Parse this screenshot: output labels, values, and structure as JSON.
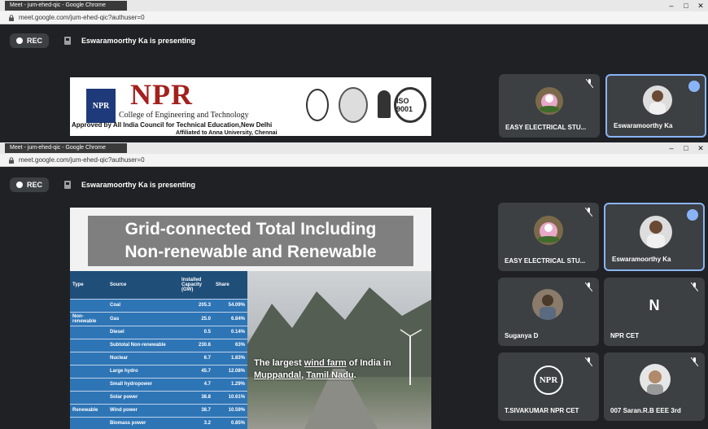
{
  "top_window": {
    "tab_title": "Meet - jum-ehed-qic - Google Chrome",
    "url": "meet.google.com/jum-ehed-qic?authuser=0",
    "rec_label": "REC",
    "presenting": "Eswaramoorthy Ka is presenting",
    "slide": {
      "logo_text": "NPR",
      "college_name": "NPR",
      "college_sub": "College of Engineering and Technology",
      "approval": "Approved by All India Council for Technical Education,New Delhi",
      "affiliation": "Affiliated to Anna University, Chennai",
      "seal_iso": "ISO 9001"
    },
    "tiles": [
      {
        "name": "EASY ELECTRICAL STU..."
      },
      {
        "name": "Eswaramoorthy Ka"
      }
    ]
  },
  "bottom_window": {
    "tab_title": "Meet - jum-ehed-qic - Google Chrome",
    "url": "meet.google.com/jum-ehed-qic?authuser=0",
    "rec_label": "REC",
    "presenting": "Eswaramoorthy Ka is presenting",
    "slide": {
      "title_line1": "Grid-connected Total Including",
      "title_line2": "Non-renewable and Renewable",
      "headers": [
        "Type",
        "Source",
        "Installed Capacity (GW)",
        "Share"
      ],
      "rows": [
        {
          "type": "",
          "source": "Coal",
          "capacity": "205.3",
          "share": "54.09%"
        },
        {
          "type": "Non-renewable",
          "source": "Gas",
          "capacity": "25.0",
          "share": "6.84%"
        },
        {
          "type": "",
          "source": "Diesel",
          "capacity": "0.5",
          "share": "0.14%"
        },
        {
          "type": "",
          "source": "Subtotal Non-renewable",
          "capacity": "230.6",
          "share": "63%"
        },
        {
          "type": "",
          "source": "Nuclear",
          "capacity": "6.7",
          "share": "1.83%"
        },
        {
          "type": "",
          "source": "Large hydro",
          "capacity": "45.7",
          "share": "12.08%"
        },
        {
          "type": "",
          "source": "Small hydropower",
          "capacity": "4.7",
          "share": "1.29%"
        },
        {
          "type": "",
          "source": "Solar power",
          "capacity": "38.8",
          "share": "10.61%"
        },
        {
          "type": "Renewable",
          "source": "Wind power",
          "capacity": "38.7",
          "share": "10.59%"
        },
        {
          "type": "",
          "source": "Biomass power",
          "capacity": "3.2",
          "share": "0.85%"
        }
      ],
      "caption_pre": "The largest ",
      "caption_link1": "wind farm",
      "caption_mid": " of India in",
      "caption_link2": "Muppandal",
      "caption_sep": ", ",
      "caption_link3": "Tamil Nadu",
      "caption_end": "."
    },
    "tiles": [
      {
        "name": "EASY ELECTRICAL STU..."
      },
      {
        "name": "Eswaramoorthy Ka"
      },
      {
        "name": "Suganya D"
      },
      {
        "name": "NPR CET",
        "initial": "N"
      },
      {
        "name": "T.SIVAKUMAR NPR CET",
        "logo": "NPR"
      },
      {
        "name": "007 Saran.R.B EEE 3rd"
      }
    ]
  },
  "colors": {
    "meet_bg": "#202124",
    "tile_bg": "#3c4043",
    "accent": "#8ab4f8",
    "slide_title_bg": "#7f7f7f",
    "table_header": "#1f4e79",
    "table_row": "#2e75b6",
    "npr_red": "#a3201d"
  },
  "icons": [
    "lock-icon",
    "rec-dot-icon",
    "present-icon",
    "mic-off-icon",
    "speaking-icon",
    "minimize-icon",
    "maximize-icon",
    "close-icon"
  ]
}
